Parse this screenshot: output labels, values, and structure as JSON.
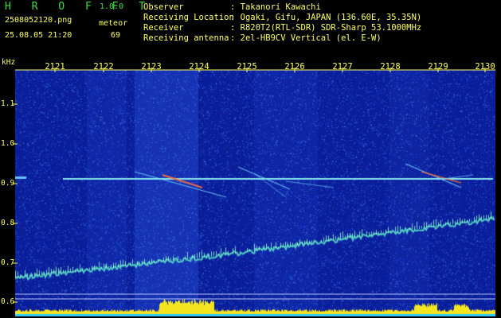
{
  "app": {
    "title": "H R O F F T",
    "version": "1.0.0"
  },
  "file": {
    "name": "2508052120.png",
    "datetime": "25.08.05 21:20"
  },
  "meteor": {
    "label": "meteor",
    "count": "69"
  },
  "station": [
    {
      "label": "Observer",
      "value": ": Takanori Kawachi"
    },
    {
      "label": "Receiving Location",
      "value": ": Ogaki, Gifu, JAPAN (136.60E, 35.35N)"
    },
    {
      "label": "Receiver",
      "value": ": R820T2(RTL-SDR) SDR-Sharp 53.1000MHz"
    },
    {
      "label": "Receiving antenna",
      "value": ": 2el-HB9CV Vertical (el. E-W)"
    }
  ],
  "axes": {
    "y_unit": "kHz",
    "y_ticks": [
      "1.1",
      "1.0",
      "0.9",
      "0.8",
      "0.7",
      "0.6"
    ],
    "x_ticks": [
      "2121",
      "2122",
      "2123",
      "2124",
      "2125",
      "2126",
      "2127",
      "2128",
      "2129",
      "2130"
    ]
  },
  "colors": {
    "title_green": "#3fdc3f",
    "label_yellow": "#ffff66",
    "background_blue": "#0a1e9a"
  }
}
